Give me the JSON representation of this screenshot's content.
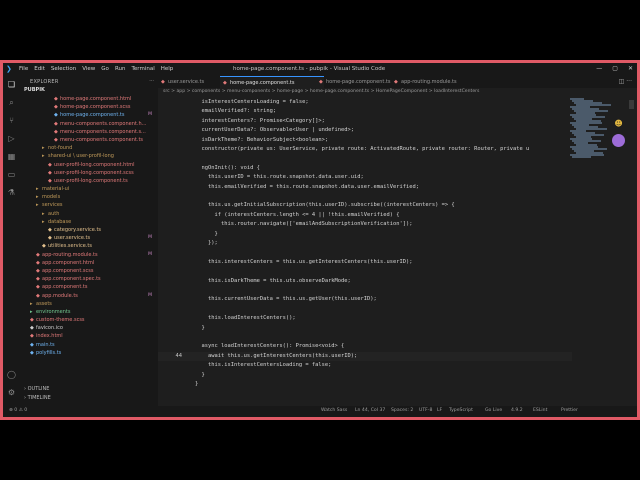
{
  "window": {
    "title": "home-page.component.ts - pubpik - Visual Studio Code",
    "menus": [
      "File",
      "Edit",
      "Selection",
      "View",
      "Go",
      "Run",
      "Terminal",
      "Help"
    ]
  },
  "sidebar": {
    "header": "EXPLORER",
    "root": "PUBPIK",
    "items": [
      {
        "label": "home-page.component.html",
        "indent": 5,
        "kind": "file",
        "color": "c-file"
      },
      {
        "label": "home-page.component.scss",
        "indent": 5,
        "kind": "file",
        "color": "c-file"
      },
      {
        "label": "home-page.component.ts",
        "indent": 5,
        "kind": "file",
        "color": "c-blue",
        "badge": "M"
      },
      {
        "label": "menu-components.component.h...",
        "indent": 5,
        "kind": "file",
        "color": "c-file"
      },
      {
        "label": "menu-components.component.s...",
        "indent": 5,
        "kind": "file",
        "color": "c-file"
      },
      {
        "label": "menu-components.component.ts",
        "indent": 5,
        "kind": "file",
        "color": "c-file"
      },
      {
        "label": "not-found",
        "indent": 3,
        "kind": "folder",
        "color": "c-folder"
      },
      {
        "label": "shared-ui \\ user-profil-long",
        "indent": 3,
        "kind": "folder",
        "color": "c-folder"
      },
      {
        "label": "user-profil-long.component.html",
        "indent": 4,
        "kind": "file",
        "color": "c-file"
      },
      {
        "label": "user-profil-long.component.scss",
        "indent": 4,
        "kind": "file",
        "color": "c-file"
      },
      {
        "label": "user-profil-long.component.ts",
        "indent": 4,
        "kind": "file",
        "color": "c-file"
      },
      {
        "label": "material-ui",
        "indent": 2,
        "kind": "folder",
        "color": "c-folder"
      },
      {
        "label": "models",
        "indent": 2,
        "kind": "folder",
        "color": "c-folder"
      },
      {
        "label": "services",
        "indent": 2,
        "kind": "folder",
        "color": "c-folder"
      },
      {
        "label": "auth",
        "indent": 3,
        "kind": "folder",
        "color": "c-folder"
      },
      {
        "label": "database",
        "indent": 3,
        "kind": "folder",
        "color": "c-folder"
      },
      {
        "label": "category.service.ts",
        "indent": 4,
        "kind": "file",
        "color": "c-yellow"
      },
      {
        "label": "user.service.ts",
        "indent": 4,
        "kind": "file",
        "color": "c-yellow",
        "badge": "M"
      },
      {
        "label": "utilities.service.ts",
        "indent": 3,
        "kind": "file",
        "color": "c-yellow"
      },
      {
        "label": "app-routing.module.ts",
        "indent": 2,
        "kind": "file",
        "color": "c-file",
        "badge": "M"
      },
      {
        "label": "app.component.html",
        "indent": 2,
        "kind": "file",
        "color": "c-file"
      },
      {
        "label": "app.component.scss",
        "indent": 2,
        "kind": "file",
        "color": "c-file"
      },
      {
        "label": "app.component.spec.ts",
        "indent": 2,
        "kind": "file",
        "color": "c-file"
      },
      {
        "label": "app.component.ts",
        "indent": 2,
        "kind": "file",
        "color": "c-file"
      },
      {
        "label": "app.module.ts",
        "indent": 2,
        "kind": "file",
        "color": "c-file",
        "badge": "M"
      },
      {
        "label": "assets",
        "indent": 1,
        "kind": "folder",
        "color": "c-folder"
      },
      {
        "label": "environments",
        "indent": 1,
        "kind": "folder",
        "color": "c-green"
      },
      {
        "label": "custom-theme.scss",
        "indent": 1,
        "kind": "file",
        "color": "c-file"
      },
      {
        "label": "favicon.ico",
        "indent": 1,
        "kind": "file",
        "color": "c-white"
      },
      {
        "label": "index.html",
        "indent": 1,
        "kind": "file",
        "color": "c-file"
      },
      {
        "label": "main.ts",
        "indent": 1,
        "kind": "file",
        "color": "c-blue"
      },
      {
        "label": "polyfills.ts",
        "indent": 1,
        "kind": "file",
        "color": "c-blue"
      }
    ],
    "outline": "OUTLINE",
    "timeline": "TIMELINE"
  },
  "tabs": [
    {
      "label": "user.service.ts",
      "active": false
    },
    {
      "label": "home-page.component.ts",
      "active": true
    },
    {
      "label": "home-page.component.ts",
      "active": false
    },
    {
      "label": "app-routing.module.ts",
      "active": false
    }
  ],
  "breadcrumb": "src > app > components > menu-components > home-page > home-page.component.ts > HomePageComponent > loadInterestCenters",
  "editor": {
    "lines": [
      {
        "n": "",
        "text": "  isInterestCentersLoading = false;"
      },
      {
        "n": "",
        "text": "  emailVerified?: string;"
      },
      {
        "n": "",
        "text": "  interestCenters?: Promise<Category[]>;"
      },
      {
        "n": "",
        "text": "  currentUserData?: Observable<User | undefined>;"
      },
      {
        "n": "",
        "text": "  isDarkTheme?: BehaviorSubject<boolean>;"
      },
      {
        "n": "",
        "text": "  constructor(private us: UserService, private route: ActivatedRoute, private router: Router, private u"
      },
      {
        "n": "",
        "text": ""
      },
      {
        "n": "",
        "text": "  ngOnInit(): void {"
      },
      {
        "n": "",
        "text": "    this.userID = this.route.snapshot.data.user.uid;"
      },
      {
        "n": "",
        "text": "    this.emailVerified = this.route.snapshot.data.user.emailVerified;"
      },
      {
        "n": "",
        "text": ""
      },
      {
        "n": "",
        "text": "    this.us.getInitialSubscription(this.userID).subscribe((interestCenters) => {"
      },
      {
        "n": "",
        "text": "      if (interestCenters.length <= 4 || !this.emailVerified) {"
      },
      {
        "n": "",
        "text": "        this.router.navigate(['emailAndSubscriptionVerification']);"
      },
      {
        "n": "",
        "text": "      }"
      },
      {
        "n": "",
        "text": "    });"
      },
      {
        "n": "",
        "text": ""
      },
      {
        "n": "",
        "text": "    this.interestCenters = this.us.getInterestCenters(this.userID);"
      },
      {
        "n": "",
        "text": ""
      },
      {
        "n": "",
        "text": "    this.isDarkTheme = this.uts.observeDarkMode;"
      },
      {
        "n": "",
        "text": ""
      },
      {
        "n": "",
        "text": "    this.currentUserData = this.us.getUser(this.userID);"
      },
      {
        "n": "",
        "text": ""
      },
      {
        "n": "",
        "text": "    this.loadInterestCenters();"
      },
      {
        "n": "",
        "text": "  }"
      },
      {
        "n": "",
        "text": ""
      },
      {
        "n": "",
        "text": "  async loadInterestCenters(): Promise<void> {"
      },
      {
        "n": "44",
        "text": "    await this.us.getInterestCenters(this.userID);"
      },
      {
        "n": "",
        "text": "    this.isInterestCentersLoading = false;"
      },
      {
        "n": "",
        "text": "  }"
      },
      {
        "n": "",
        "text": "}"
      },
      {
        "n": "",
        "text": ""
      }
    ],
    "current_line_index": 27
  },
  "status": {
    "left": "⊗ 0 ⚠ 0",
    "items": [
      "Watch Sass",
      "Ln 44, Col 37",
      "Spaces: 2",
      "UTF-8",
      "LF",
      "TypeScript",
      "Go Live",
      "4.9.2",
      "ESLint",
      "Prettier"
    ]
  },
  "colors": {
    "accent": "#3794ff",
    "frame": "#e05a66"
  }
}
